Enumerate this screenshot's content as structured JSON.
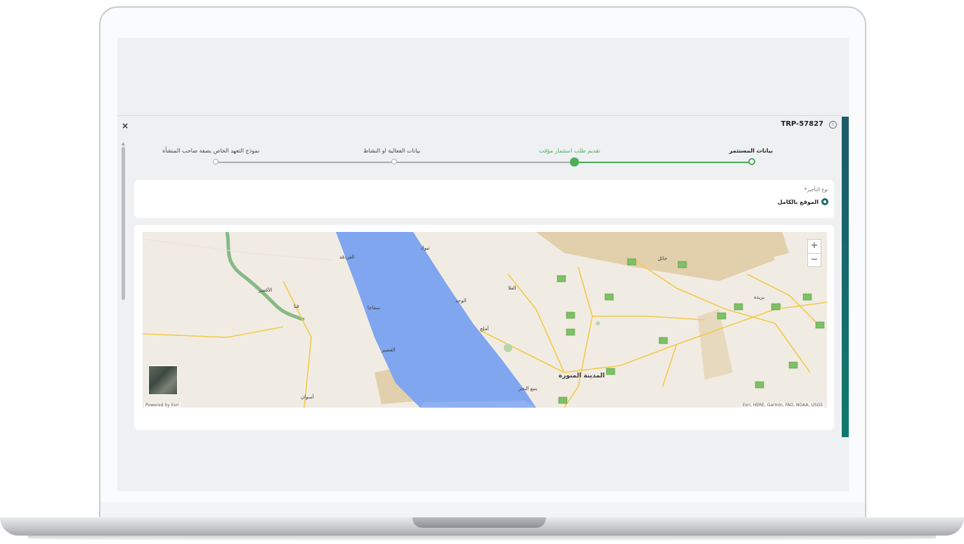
{
  "modal": {
    "close_label": "×",
    "reference": "TRP-57827",
    "info_icon": "info-icon"
  },
  "stepper": {
    "steps": [
      {
        "label": "بيانات المستثمر",
        "state": "done"
      },
      {
        "label": "تقديم طلب استثمار مؤقت",
        "state": "current"
      },
      {
        "label": "بيانات الفعالية او النشاط",
        "state": "pending"
      },
      {
        "label": "نموذج التعهد الخاص بصفة صاحب المنشأة",
        "state": "pending"
      }
    ]
  },
  "lease_type": {
    "label": "نوع التأجير",
    "required_mark": "*",
    "option": "الموقع بالكامل"
  },
  "map": {
    "zoom_in": "+",
    "zoom_out": "−",
    "powered_by": "Powered by Esri",
    "attribution": "Esri, HERE, Garmin, FAO, NOAA, USGS",
    "cities": [
      "المدينة المنورة",
      "حائل",
      "بريدة",
      "العلا",
      "تبوك",
      "ينبع البحر",
      "الغردقة",
      "سفاجا",
      "القصير",
      "أسوان",
      "الأقصر",
      "قنا",
      "الوجه",
      "أملج"
    ],
    "colors": {
      "sea": "#7fa6ef",
      "land": "#f1ece3",
      "desert": "#e2cfac",
      "nile": "#86b987",
      "road": "#f2c94c"
    }
  },
  "colors": {
    "accent": "#4cae59",
    "pending": "#a9adb3",
    "radio": "#1d6b6e",
    "strip": "#0e7a6e"
  }
}
